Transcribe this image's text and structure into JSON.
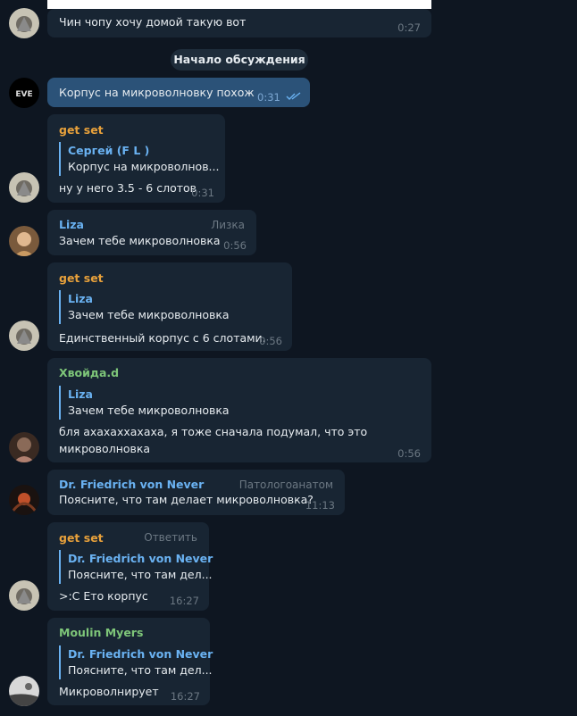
{
  "service_message": "Начало обсуждения",
  "colors": {
    "orange_name": "#e8a13b",
    "blue_name": "#6ab2f2",
    "green_name": "#7ec679",
    "purple_name": "#b99bf0"
  },
  "messages": {
    "m0": {
      "text": "Чин чопу хочу домой такую вот",
      "time": "0:27"
    },
    "m1": {
      "text": "Корпус на микроволновку похож",
      "time": "0:31"
    },
    "m2": {
      "sender": "get set",
      "quote_name": "Сергей (F L )",
      "quote_text": "Корпус на микроволнов...",
      "text": "ну у него 3.5 - 6 слотов",
      "time": "0:31"
    },
    "m3": {
      "sender": "Liza",
      "tag": "Лизка",
      "text": "Зачем тебе микроволновка",
      "time": "0:56"
    },
    "m4": {
      "sender": "get set",
      "quote_name": "Liza",
      "quote_text": "Зачем тебе микроволновка",
      "text": "Единственный корпус с 6 слотами.",
      "time": "0:56"
    },
    "m5": {
      "sender": "Хвойда.d",
      "quote_name": "Liza",
      "quote_text": "Зачем тебе микроволновка",
      "text_line1": "бля ахахаххахаха, я тоже сначала подумал, что это",
      "text_line2": "микроволновка",
      "time": "0:56"
    },
    "m6": {
      "sender": "Dr. Friedrich von Never",
      "tag": "Патологоанатом",
      "text": "Поясните, что там делает микроволновка?",
      "time": "11:13"
    },
    "m7": {
      "sender": "get set",
      "tag": "Ответить",
      "quote_name": "Dr. Friedrich von Never",
      "quote_text": "Поясните, что там дел...",
      "text": ">:С Ето корпус",
      "time": "16:27"
    },
    "m8": {
      "sender": "Moulin Myers",
      "quote_name": "Dr. Friedrich von Never",
      "quote_text": "Поясните, что там дел...",
      "text": "Микроволнирует",
      "time": "16:27"
    }
  }
}
